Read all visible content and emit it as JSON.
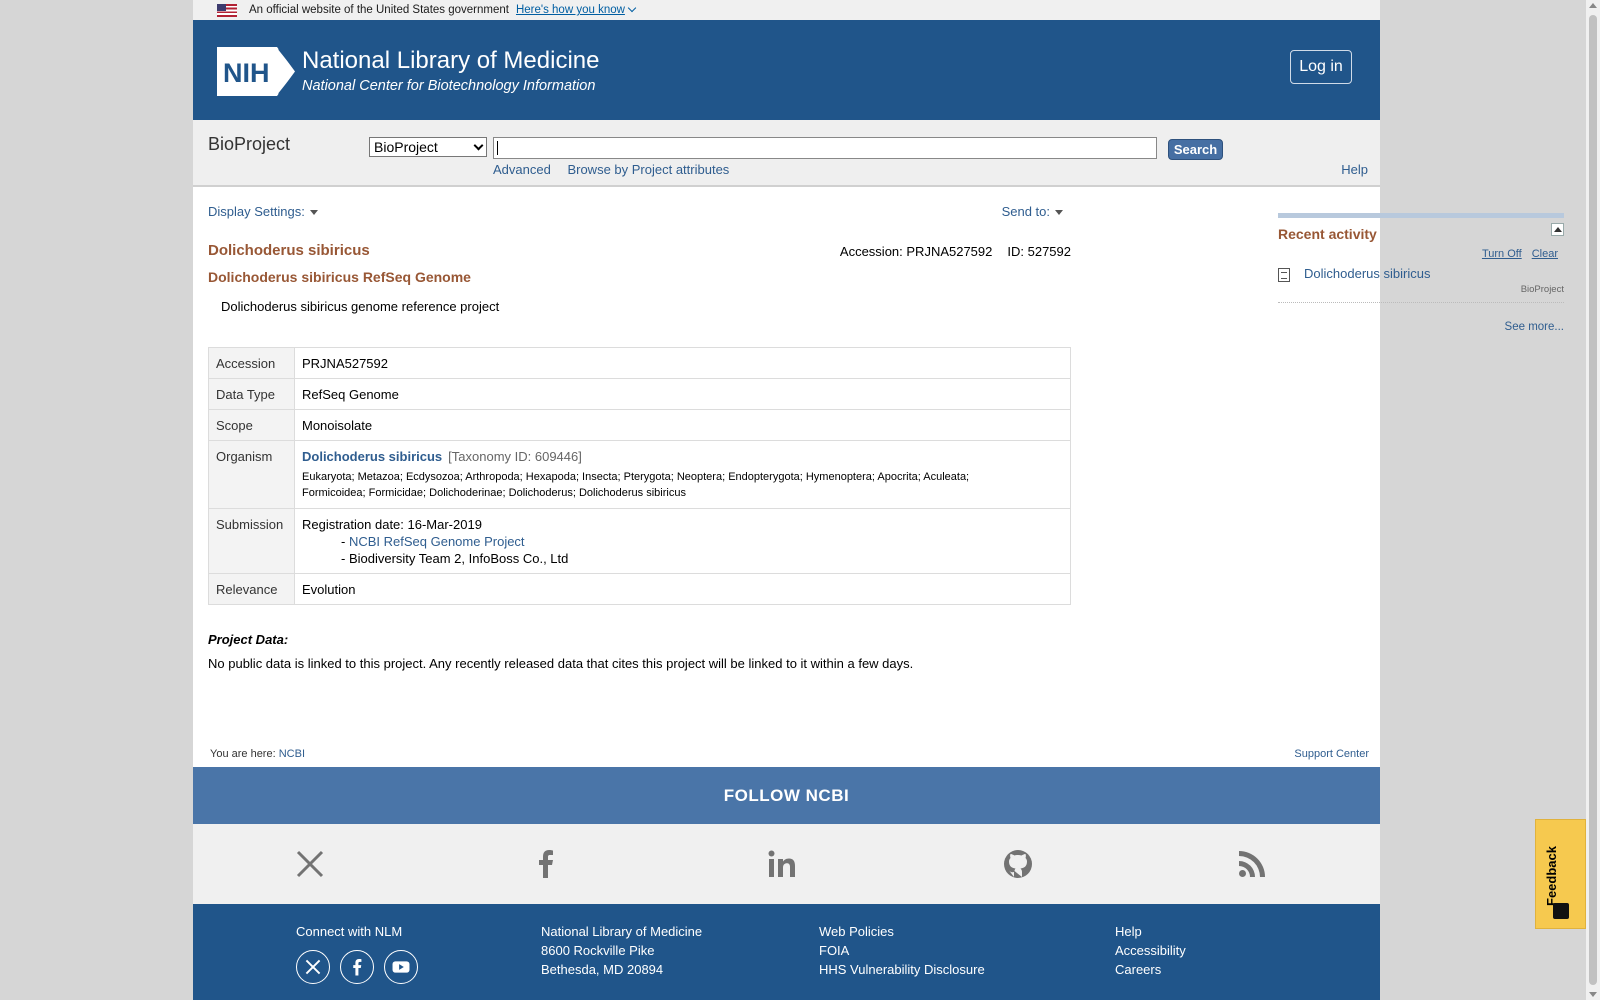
{
  "gov_banner": {
    "text": "An official website of the United States government",
    "link": "Here's how you know"
  },
  "header": {
    "logo_text": "NIH",
    "title": "National Library of Medicine",
    "subtitle": "National Center for Biotechnology Information",
    "login": "Log in"
  },
  "search": {
    "db_name": "BioProject",
    "db_selected": "BioProject",
    "query": "",
    "button": "Search",
    "links": [
      "Advanced",
      "Browse by Project attributes"
    ],
    "help": "Help"
  },
  "toolbar": {
    "display_settings": "Display Settings:",
    "send_to": "Send to:"
  },
  "record": {
    "title": "Dolichoderus sibiricus",
    "accession_label": "Accession: PRJNA527592",
    "id_label": "ID: 527592",
    "subtitle": "Dolichoderus sibiricus RefSeq Genome",
    "description": "Dolichoderus sibiricus genome reference project"
  },
  "table": {
    "accession": {
      "label": "Accession",
      "value": "PRJNA527592"
    },
    "data_type": {
      "label": "Data Type",
      "value": "RefSeq Genome"
    },
    "scope": {
      "label": "Scope",
      "value": "Monoisolate"
    },
    "organism": {
      "label": "Organism",
      "name": "Dolichoderus sibiricus",
      "taxonomy": "[Taxonomy ID: 609446]",
      "lineage_1": "Eukaryota; Metazoa; Ecdysozoa; Arthropoda; Hexapoda; Insecta; Pterygota; Neoptera; Endopterygota; Hymenoptera; Apocrita; Aculeata;",
      "lineage_2": "Formicoidea; Formicidae; Dolichoderinae; Dolichoderus; Dolichoderus sibiricus"
    },
    "submission": {
      "label": "Submission",
      "date": "Registration date: 16-Mar-2019",
      "dash": "-",
      "link": "NCBI RefSeq Genome Project",
      "org": "- Biodiversity Team 2, InfoBoss Co., Ltd"
    },
    "relevance": {
      "label": "Relevance",
      "value": "Evolution"
    }
  },
  "project_data": {
    "heading": "Project Data:",
    "text": "No public data is linked to this project. Any recently released data that cites this project will be linked to it within a few days."
  },
  "recent_activity": {
    "title": "Recent activity",
    "turn_off": "Turn Off",
    "clear": "Clear",
    "item_title": "Dolichoderus sibiricus",
    "item_db": "BioProject",
    "see_more": "See more..."
  },
  "breadcrumb": {
    "prefix": "You are here:",
    "link": "NCBI",
    "support": "Support Center"
  },
  "footer": {
    "follow": "FOLLOW NCBI",
    "connect": "Connect with NLM",
    "address": [
      "National Library of Medicine",
      "8600 Rockville Pike",
      "Bethesda, MD 20894"
    ],
    "policies": [
      "Web Policies",
      "FOIA",
      "HHS Vulnerability Disclosure"
    ],
    "help": [
      "Help",
      "Accessibility",
      "Careers"
    ]
  },
  "feedback": "Feedback",
  "colors": {
    "header_blue": "#20558a",
    "title_brown": "#985735",
    "link_blue": "#2f5d8f",
    "follow_blue": "#4a75a8",
    "feedback_yellow": "#f6c94f"
  },
  "icons": [
    "flag-icon",
    "chevron-down-icon",
    "nih-logo-icon",
    "dropdown-arrow-icon",
    "collapse-icon",
    "document-icon",
    "x-icon",
    "facebook-icon",
    "linkedin-icon",
    "github-icon",
    "rss-icon",
    "youtube-icon",
    "feedback-icon"
  ]
}
